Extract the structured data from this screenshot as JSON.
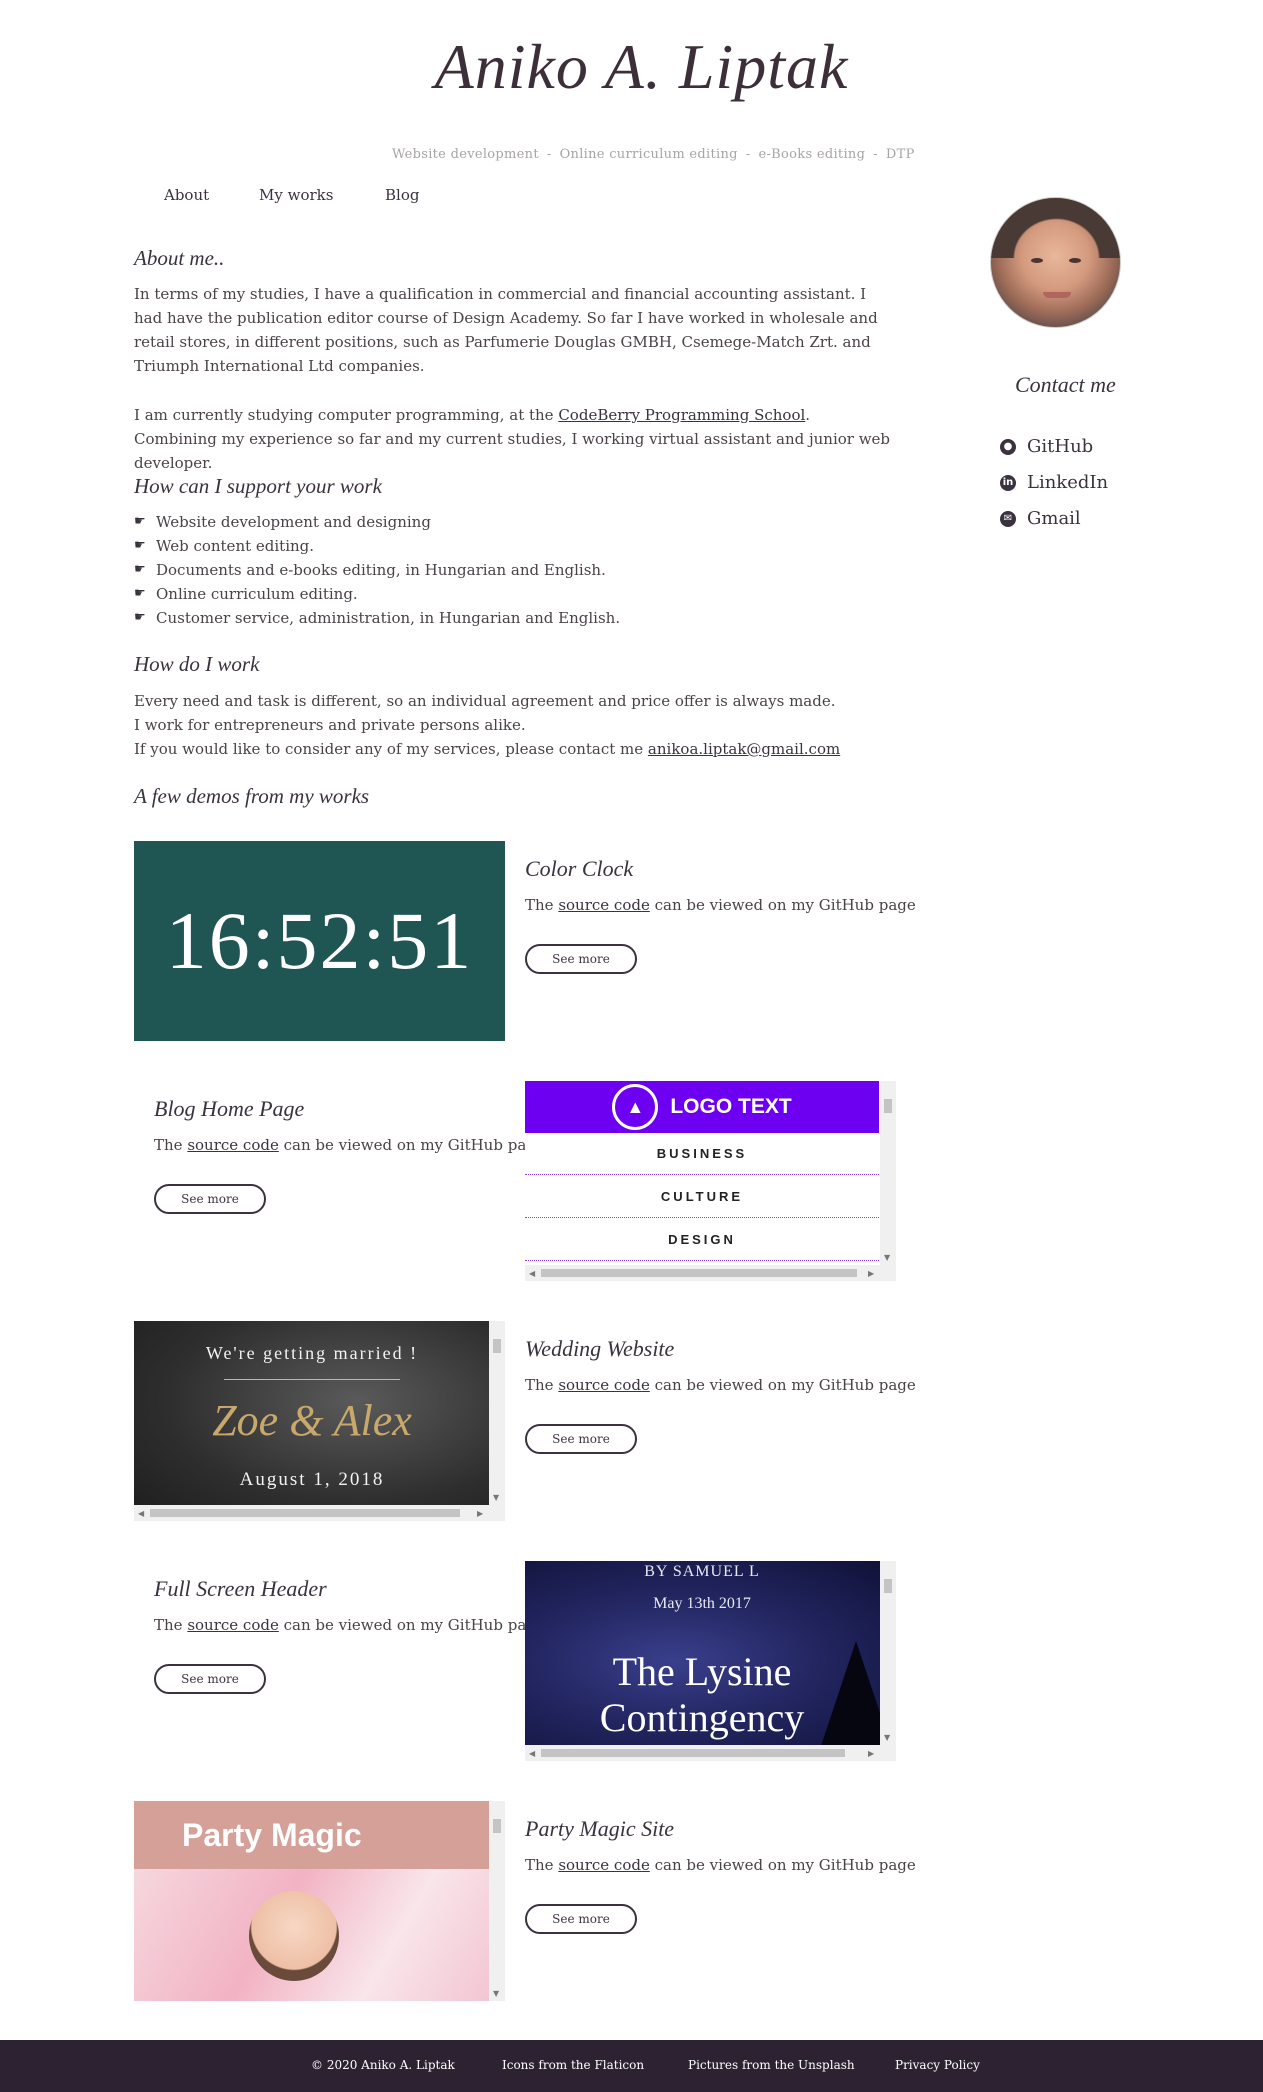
{
  "header": {
    "site_title": "Aniko A. Liptak",
    "tagline": [
      "Website development",
      "Online curriculum editing",
      "e-Books editing",
      "DTP"
    ],
    "tagline_separator": "-"
  },
  "nav": {
    "items": [
      "About",
      "My works",
      "Blog"
    ]
  },
  "sidebar": {
    "contact_title": "Contact me",
    "links": [
      {
        "label": "GitHub",
        "icon": "github-icon"
      },
      {
        "label": "LinkedIn",
        "icon": "linkedin-icon"
      },
      {
        "label": "Gmail",
        "icon": "gmail-icon"
      }
    ]
  },
  "about": {
    "heading": "About me..",
    "paragraph1": "In terms of my studies, I have a qualification in commercial and financial accounting assistant. I had have the publication editor course of Design Academy. So far I have worked in wholesale and retail stores, in different positions, such as Parfumerie Douglas GMBH, Csemege-Match Zrt. and Triumph International Ltd companies.",
    "paragraph2_pre": "I am currently studying computer programming, at the ",
    "paragraph2_link": "CodeBerry Programming School",
    "paragraph2_post": ". Combining my experience so far and my current studies, I working virtual assistant and junior web developer."
  },
  "support": {
    "heading": "How can I support your work",
    "items": [
      "Website development and designing",
      "Web content editing.",
      "Documents and e-books editing, in Hungarian and English.",
      "Online curriculum editing.",
      "Customer service, administration, in Hungarian and English."
    ]
  },
  "how": {
    "heading": "How do I work",
    "line1": "Every need and task is different, so an individual agreement and price offer is always made.",
    "line2": "I work for entrepreneurs and private persons alike.",
    "line3_pre": "If you would like to consider any of my services, please contact me ",
    "email": "anikoa.liptak@gmail.com"
  },
  "demos": {
    "heading": "A few demos from my works",
    "desc_pre": "The ",
    "desc_link": "source code",
    "desc_post": " can be viewed on my GitHub page",
    "see_more": "See more",
    "items": [
      {
        "title": "Color Clock",
        "preview_text": "16:52:51"
      },
      {
        "title": "Blog Home Page",
        "preview_logo": "LOGO TEXT",
        "preview_nav": [
          "BUSINESS",
          "CULTURE",
          "DESIGN"
        ]
      },
      {
        "title": "Wedding Website",
        "preview_line1": "We're getting married !",
        "preview_names": "Zoe & Alex",
        "preview_date": "August 1, 2018"
      },
      {
        "title": "Full Screen Header",
        "preview_by": "BY SAMUEL L",
        "preview_date": "May 13th 2017",
        "preview_title1": "The Lysine",
        "preview_title2": "Contingency"
      },
      {
        "title": "Party Magic Site",
        "preview_head": "Party Magic"
      }
    ]
  },
  "footer": {
    "copyright": "© 2020   Aniko A. Liptak",
    "icons_credit": "Icons from the Flaticon",
    "pictures_credit": "Pictures from the Unsplash",
    "privacy": "Privacy Policy"
  },
  "colors": {
    "text": "#3b3240",
    "footer_bg": "#2c2231",
    "clock_bg": "#1f5552",
    "blog_accent": "#6d00f0",
    "party_accent": "#d5a098"
  }
}
